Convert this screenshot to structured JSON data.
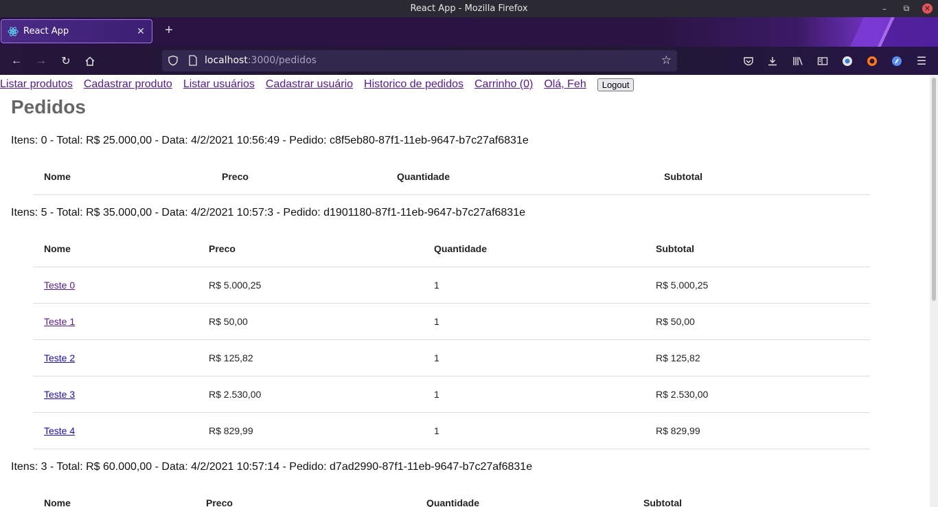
{
  "window": {
    "title": "React App - Mozilla Firefox"
  },
  "tab": {
    "label": "React App"
  },
  "url": {
    "host": "localhost",
    "rest": ":3000/pedidos"
  },
  "menu": {
    "listar_produtos": "Listar produtos",
    "cadastrar_produto": "Cadastrar produto",
    "listar_usuarios": "Listar usuários",
    "cadastrar_usuario": "Cadastrar usuário",
    "historico": "Historico de pedidos",
    "carrinho": "Carrinho (0)",
    "ola": "Olá, Feh",
    "logout": "Logout"
  },
  "page_title": "Pedidos",
  "columns": {
    "nome": "Nome",
    "preco": "Preco",
    "quantidade": "Quantidade",
    "subtotal": "Subtotal"
  },
  "orders": [
    {
      "summary": "Itens: 0 - Total: R$ 25.000,00 - Data: 4/2/2021 10:56:49 - Pedido: c8f5eb80-87f1-11eb-9647-b7c27af6831e",
      "items": []
    },
    {
      "summary": "Itens: 5 - Total: R$ 35.000,00 - Data: 4/2/2021 10:57:3 - Pedido: d1901180-87f1-11eb-9647-b7c27af6831e",
      "items": [
        {
          "nome": "Teste 0",
          "preco": "R$ 5.000,25",
          "quantidade": "1",
          "subtotal": "R$ 5.000,25"
        },
        {
          "nome": "Teste 1",
          "preco": "R$ 50,00",
          "quantidade": "1",
          "subtotal": "R$ 50,00"
        },
        {
          "nome": "Teste 2",
          "preco": "R$ 125,82",
          "quantidade": "1",
          "subtotal": "R$ 125,82"
        },
        {
          "nome": "Teste 3",
          "preco": "R$ 2.530,00",
          "quantidade": "1",
          "subtotal": "R$ 2.530,00"
        },
        {
          "nome": "Teste 4",
          "preco": "R$ 829,99",
          "quantidade": "1",
          "subtotal": "R$ 829,99"
        }
      ]
    },
    {
      "summary": "Itens: 3 - Total: R$ 60.000,00 - Data: 4/2/2021 10:57:14 - Pedido: d7ad2990-87f1-11eb-9647-b7c27af6831e",
      "items": []
    }
  ]
}
